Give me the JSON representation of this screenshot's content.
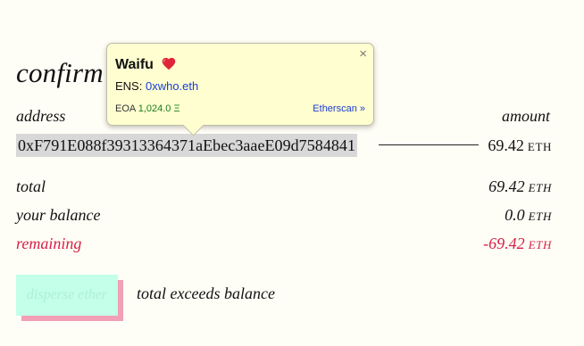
{
  "confirm": {
    "title": "confirm",
    "header_address": "address",
    "header_amount": "amount"
  },
  "recipient": {
    "address": "0xF791E088f39313364371aEbec3aaeE09d7584841",
    "amount": "69.42",
    "unit": "ETH"
  },
  "summary": {
    "total_label": "total",
    "total_value": "69.42",
    "total_unit": "ETH",
    "balance_label": "your balance",
    "balance_value": "0.0",
    "balance_unit": "ETH",
    "remaining_label": "remaining",
    "remaining_value": "-69.42",
    "remaining_unit": "ETH"
  },
  "action": {
    "button_label": "disperse ether",
    "message": "total exceeds balance"
  },
  "tooltip": {
    "close": "×",
    "name": "Waifu",
    "ens_label": "ENS:",
    "ens_name": "0xwho.eth",
    "account_type": "EOA",
    "balance": "1,024.0 Ξ",
    "link": "Etherscan »",
    "heart_icon": "heart-icon"
  },
  "colors": {
    "background": "#fffef6",
    "remaining": "#d61f46",
    "button": "#c3ffe9",
    "button_shadow": "#f2a0b5",
    "tooltip_bg": "#fffed0",
    "link": "#1a3cd6",
    "balance_green": "#1a7d1a"
  }
}
